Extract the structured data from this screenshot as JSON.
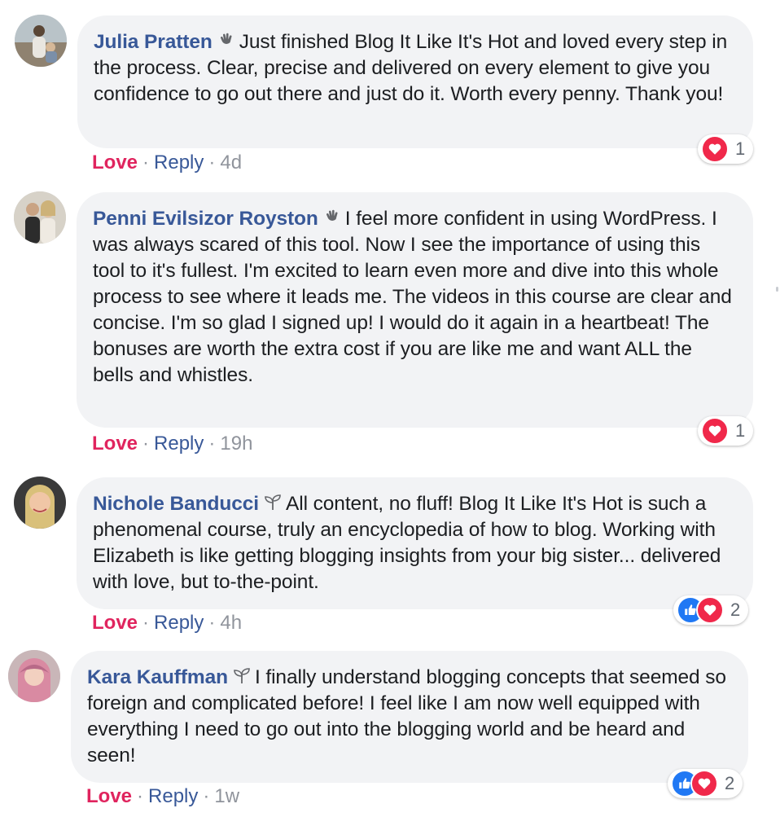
{
  "colors": {
    "author": "#385898",
    "love": "#e0245e",
    "bubble": "#f2f3f5",
    "love_reaction": "#f0284a",
    "like_reaction": "#2078f4"
  },
  "comments": [
    {
      "author": "Julia Pratten",
      "badge_icon": "waving-hand-icon",
      "text": "Just finished Blog It Like It's Hot and loved every step in the process. Clear, precise and delivered on every element to give you confidence to go out there and just do it. Worth every penny. Thank you!",
      "reaction_label": "Love",
      "reply_label": "Reply",
      "separator": "·",
      "time": "4d",
      "reaction_icons": [
        "love-reaction-icon"
      ],
      "reaction_count": "1"
    },
    {
      "author": "Penni Evilsizor Royston",
      "badge_icon": "waving-hand-icon",
      "text": "I feel more confident in using WordPress. I was always scared of this tool. Now I see the importance of using this tool to it's fullest. I'm excited to learn even more and dive into this whole process to see where it leads me. The videos in this course are clear and concise. I'm so glad I signed up! I would do it again in a heartbeat! The bonuses are worth the extra cost if you are like me and want ALL the bells and whistles.",
      "reaction_label": "Love",
      "reply_label": "Reply",
      "separator": "·",
      "time": "19h",
      "reaction_icons": [
        "love-reaction-icon"
      ],
      "reaction_count": "1"
    },
    {
      "author": "Nichole Banducci",
      "badge_icon": "sprout-icon",
      "text": "All content, no fluff! Blog It Like It's Hot is such a phenomenal course, truly an encyclopedia of how to blog. Working with Elizabeth is like getting blogging insights from your big sister... delivered with love, but to-the-point.",
      "reaction_label": "Love",
      "reply_label": "Reply",
      "separator": "·",
      "time": "4h",
      "reaction_icons": [
        "like-reaction-icon",
        "love-reaction-icon"
      ],
      "reaction_count": "2"
    },
    {
      "author": "Kara Kauffman",
      "badge_icon": "sprout-icon",
      "text": "I finally understand blogging concepts that seemed so foreign and complicated before! I feel like I am now well equipped with everything I need to go out into the blogging world and be heard and seen!",
      "reaction_label": "Love",
      "reply_label": "Reply",
      "separator": "·",
      "time": "1w",
      "reaction_icons": [
        "like-reaction-icon",
        "love-reaction-icon"
      ],
      "reaction_count": "2"
    }
  ]
}
